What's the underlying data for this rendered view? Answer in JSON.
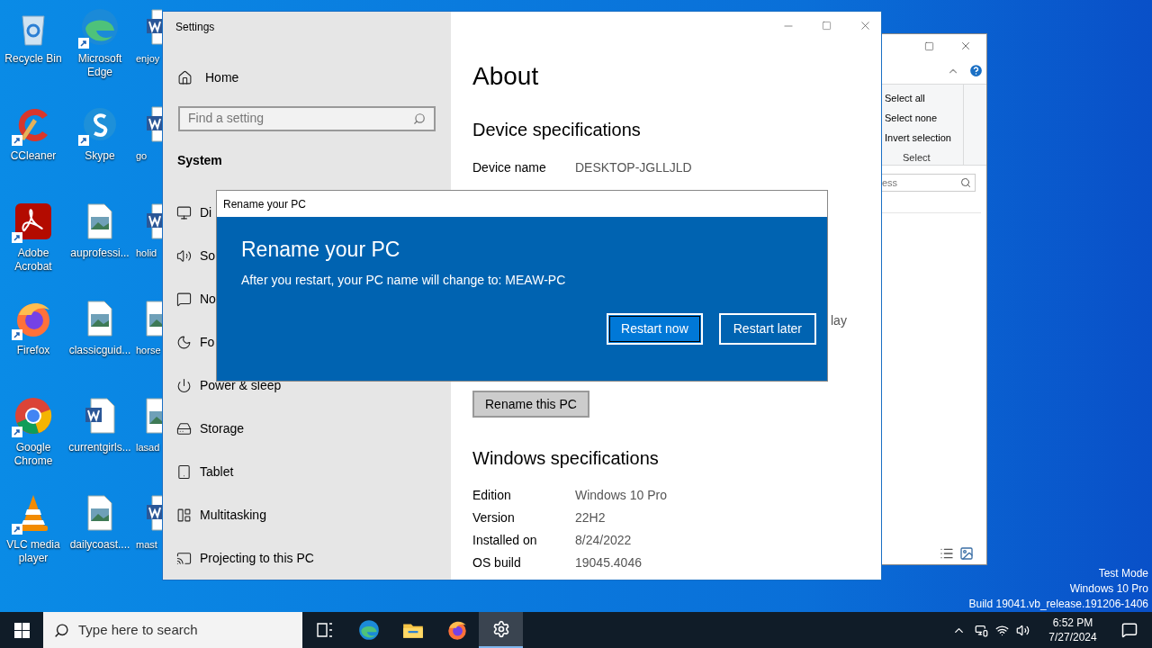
{
  "desktop": {
    "icons": [
      {
        "label": "Recycle Bin",
        "kind": "recycle",
        "shortcut": false
      },
      {
        "label": "Microsoft Edge",
        "kind": "edge",
        "shortcut": true
      },
      {
        "label": "enjoy",
        "kind": "word",
        "shortcut": false
      },
      {
        "label": "CCleaner",
        "kind": "ccleaner",
        "shortcut": true
      },
      {
        "label": "Skype",
        "kind": "skype",
        "shortcut": true
      },
      {
        "label": "go",
        "kind": "word",
        "shortcut": false
      },
      {
        "label": "Adobe Acrobat",
        "kind": "acrobat",
        "shortcut": true
      },
      {
        "label": "auprofessi...",
        "kind": "image",
        "shortcut": false
      },
      {
        "label": "holid",
        "kind": "word",
        "shortcut": false
      },
      {
        "label": "Firefox",
        "kind": "firefox",
        "shortcut": true
      },
      {
        "label": "classicguid...",
        "kind": "image",
        "shortcut": false
      },
      {
        "label": "horse",
        "kind": "image",
        "shortcut": false
      },
      {
        "label": "Google Chrome",
        "kind": "chrome",
        "shortcut": true
      },
      {
        "label": "currentgirls...",
        "kind": "word",
        "shortcut": false
      },
      {
        "label": "lasad",
        "kind": "image",
        "shortcut": false
      },
      {
        "label": "VLC media player",
        "kind": "vlc",
        "shortcut": true
      },
      {
        "label": "dailycoast....",
        "kind": "image",
        "shortcut": false
      },
      {
        "label": "mast",
        "kind": "word",
        "shortcut": false
      }
    ],
    "system_info": [
      "Test Mode",
      "Windows 10 Pro",
      "Build 19041.vb_release.191206-1406"
    ]
  },
  "explorer": {
    "ribbon_items": [
      "Select all",
      "Select none",
      "Invert selection"
    ],
    "ribbon_group": "Select",
    "search": {
      "placeholder": "ess"
    }
  },
  "settings": {
    "title": "Settings",
    "home": "Home",
    "search": {
      "placeholder": "Find a setting"
    },
    "section": "System",
    "nav": [
      {
        "label": "Di",
        "kind": "display"
      },
      {
        "label": "So",
        "kind": "sound"
      },
      {
        "label": "No",
        "kind": "notifications"
      },
      {
        "label": "Fo",
        "kind": "focus"
      },
      {
        "label": "Power & sleep",
        "kind": "power"
      },
      {
        "label": "Storage",
        "kind": "storage"
      },
      {
        "label": "Tablet",
        "kind": "tablet"
      },
      {
        "label": "Multitasking",
        "kind": "multitasking"
      },
      {
        "label": "Projecting to this PC",
        "kind": "projecting"
      }
    ],
    "page_title": "About",
    "device_heading": "Device specifications",
    "device_specs": [
      {
        "label": "Device name",
        "value": "DESKTOP-JGLLJLD"
      }
    ],
    "fragment": "lay",
    "rename_button": "Rename this PC",
    "windows_heading": "Windows specifications",
    "windows_specs": [
      {
        "label": "Edition",
        "value": "Windows 10 Pro"
      },
      {
        "label": "Version",
        "value": "22H2"
      },
      {
        "label": "Installed on",
        "value": "8/24/2022"
      },
      {
        "label": "OS build",
        "value": "19045.4046"
      }
    ]
  },
  "dialog": {
    "title": "Rename your PC",
    "heading": "Rename your PC",
    "message": "After you restart, your PC name will change to: MEAW-PC",
    "buttons": [
      {
        "label": "Restart now",
        "focused": true
      },
      {
        "label": "Restart later",
        "focused": false
      }
    ]
  },
  "taskbar": {
    "search": {
      "placeholder": "Type here to search"
    },
    "apps": [
      {
        "kind": "taskview",
        "active": false
      },
      {
        "kind": "edge",
        "active": false
      },
      {
        "kind": "explorer",
        "active": false
      },
      {
        "kind": "firefox",
        "active": false
      },
      {
        "kind": "settings",
        "active": true
      }
    ],
    "time": "6:52 PM",
    "date": "7/27/2024"
  }
}
